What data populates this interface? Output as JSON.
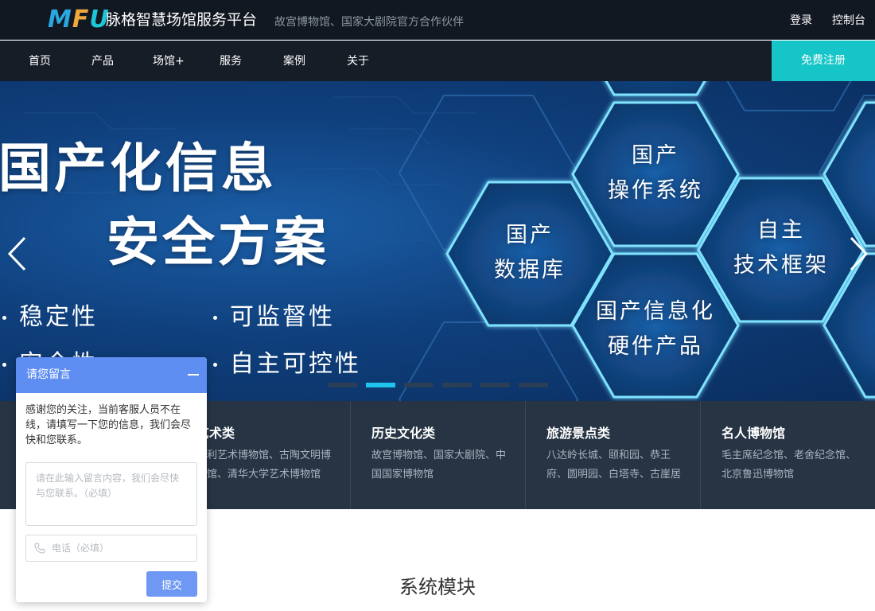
{
  "header": {
    "logo": "MFU",
    "brand": "脉格智慧场馆服务平台",
    "tagline": "故宫博物馆、国家大剧院官方合作伙伴",
    "login": "登录",
    "console": "控制台"
  },
  "nav": {
    "items": [
      "首页",
      "产品",
      "场馆+",
      "服务",
      "案例",
      "关于"
    ],
    "register": "免费注册"
  },
  "hero": {
    "title_line1": "国产化信息",
    "title_line2": "安全方案",
    "bullets": [
      "稳定性",
      "可监督性",
      "安全性",
      "自主可控性"
    ],
    "hexagons": [
      {
        "line1": "国产",
        "line2": "操作系统"
      },
      {
        "line1": "国产",
        "line2": "数据库"
      },
      {
        "line1": "自主",
        "line2": "技术框架"
      },
      {
        "line1": "国产信息化",
        "line2": "硬件产品"
      }
    ],
    "slide_count": 6,
    "active_slide": 2
  },
  "categories": [
    {
      "title": "艺术类",
      "desc": "保利艺术博物馆、古陶文明博物馆、清华大学艺术博物馆"
    },
    {
      "title": "历史文化类",
      "desc": "故宫博物馆、国家大剧院、中国国家博物馆"
    },
    {
      "title": "旅游景点类",
      "desc": "八达岭长城、颐和园、恭王府、圆明园、白塔寺、古崖居"
    },
    {
      "title": "名人博物馆",
      "desc": "毛主席纪念馆、老舍纪念馆、北京鲁迅博物馆"
    }
  ],
  "section": {
    "title": "系统模块"
  },
  "chat": {
    "title": "请您留言",
    "message": "感谢您的关注，当前客服人员不在线，请填写一下您的信息，我们会尽快和您联系。",
    "message_placeholder": "请在此输入留言内容，我们会尽快与您联系。（必填）",
    "phone_placeholder": "电话（必填）",
    "submit": "提交"
  },
  "colors": {
    "topbar": "#121821",
    "accent": "#15c5c8",
    "chat_blue": "#5f8ef3",
    "indicator_active": "#1ec4ee"
  },
  "icons": [
    "chevron-left-icon",
    "chevron-right-icon",
    "minimize-icon",
    "phone-icon"
  ]
}
